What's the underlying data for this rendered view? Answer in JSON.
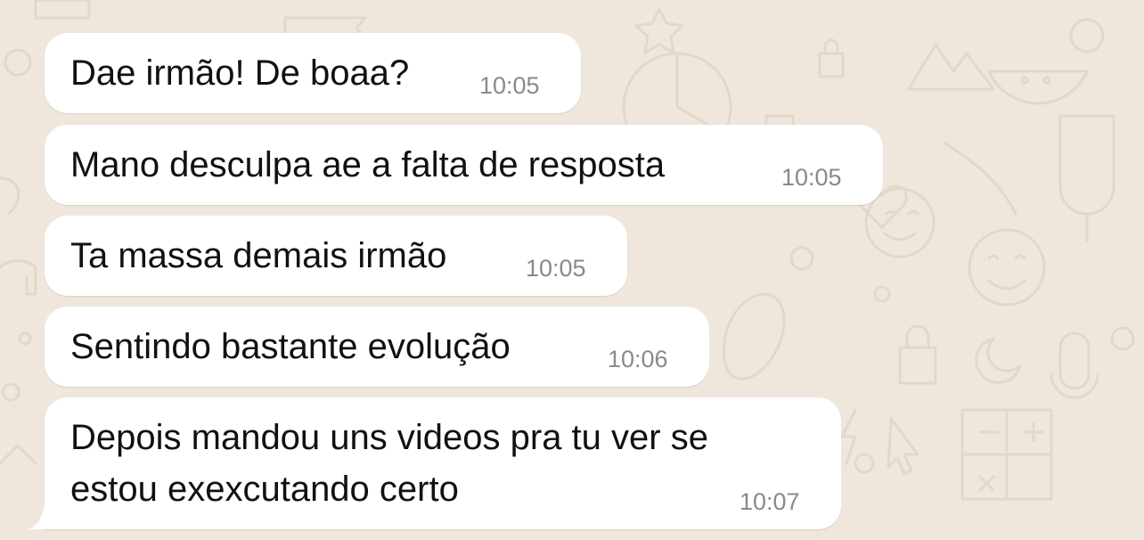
{
  "chat": {
    "messages": [
      {
        "text": "Dae irmão! De boaa?",
        "time": "10:05"
      },
      {
        "text": "Mano desculpa ae a falta de resposta",
        "time": "10:05"
      },
      {
        "text": "Ta massa demais irmão",
        "time": "10:05"
      },
      {
        "text": "Sentindo bastante evolução",
        "time": "10:06"
      },
      {
        "lines": [
          "Depois mandou uns videos pra tu ver se",
          "estou exexcutando certo"
        ],
        "time": "10:07"
      }
    ]
  },
  "colors": {
    "wallpaper": "#efe7dc",
    "doodle": "#e3d9cb",
    "bubble": "#ffffff",
    "text": "#111111",
    "timestamp": "#8a8a8a"
  },
  "icons": [
    "chat-wallpaper-doodles",
    "bubble-tail"
  ]
}
